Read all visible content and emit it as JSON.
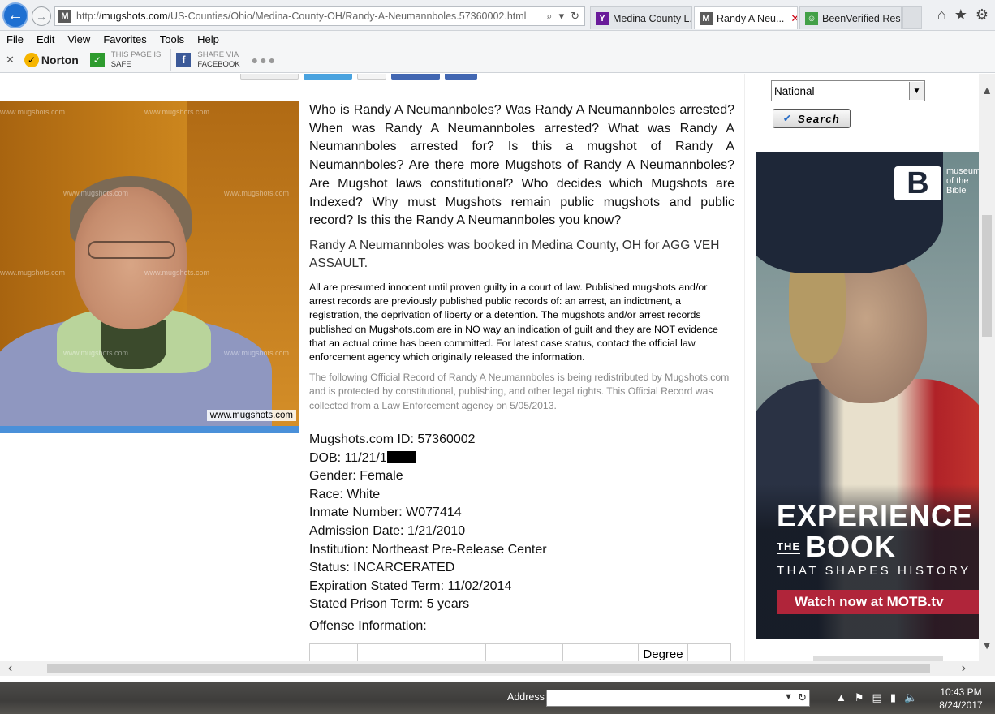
{
  "browser": {
    "url_domain": "mugshots.com",
    "url_prefix": "http://",
    "url_path": "/US-Counties/Ohio/Medina-County-OH/Randy-A-Neumannboles.57360002.html",
    "tabs": [
      {
        "label": "Medina County L...",
        "icon": "Y",
        "icon_color": "#6a1b9a",
        "active": false
      },
      {
        "label": "Randy A Neu...",
        "icon": "M",
        "icon_color": "#5a5a5a",
        "active": true
      },
      {
        "label": "BeenVerified Res...",
        "icon": "☺",
        "icon_color": "#43a047",
        "active": false
      }
    ],
    "menu": [
      "File",
      "Edit",
      "View",
      "Favorites",
      "Tools",
      "Help"
    ],
    "norton_label": "Norton",
    "safe_top": "THIS PAGE IS",
    "safe_bottom": "SAFE",
    "share_top": "SHARE VIA",
    "share_bottom": "FACEBOOK"
  },
  "mugshot": {
    "caption": "www.mugshots.com",
    "watermark": "www.mugshots.com"
  },
  "content": {
    "questions": "Who is Randy A Neumannboles? Was Randy A Neumannboles arrested? When was Randy A Neumannboles arrested? What was Randy A Neumannboles arrested for? Is this a mugshot of Randy A Neumannboles? Are there more Mugshots of Randy A Neumannboles? Are Mugshot laws constitutional? Who decides which Mugshots are Indexed? Why must Mugshots remain public mugshots and public record? Is this the Randy A Neumannboles you know?",
    "booked": "Randy A Neumannboles was booked in Medina County, OH for AGG VEH ASSAULT.",
    "disclaimer": "All are presumed innocent until proven guilty in a court of law. Published mugshots and/or arrest records are previously published public records of: an arrest, an indictment, a registration, the deprivation of liberty or a detention. The mugshots and/or arrest records published on Mugshots.com are in NO way an indication of guilt and they are NOT evidence that an actual crime has been committed. For latest case status, contact the official law enforcement agency which originally released the information.",
    "redistribution": "The following Official Record of Randy A Neumannboles is being redistributed by Mugshots.com and is protected by constitutional, publishing, and other legal rights. This Official Record was collected from a Law Enforcement agency on 5/05/2013.",
    "facts": {
      "id": "Mugshots.com ID: 57360002",
      "dob": "DOB: 11/21/1",
      "gender": "Gender: Female",
      "race": "Race: White",
      "inmate": "Inmate Number: W077414",
      "admission": "Admission Date: 1/21/2010",
      "institution": "Institution: Northeast Pre-Release Center",
      "status": "Status: INCARCERATED",
      "expiration": "Expiration Stated Term: 11/02/2014",
      "term": "Stated Prison Term: 5 years"
    },
    "offense_title": "Offense Information:",
    "offense_header_visible": "Degree"
  },
  "sidebar": {
    "select_value": "National",
    "search_label": "Search"
  },
  "ad": {
    "logo_lines": [
      "museum",
      "of the",
      "Bible"
    ],
    "headline1": "EXPERIENCE",
    "the": "THE",
    "headline2": "BOOK",
    "headline3": "THAT SHAPES HISTORY",
    "cta": "Watch now at MOTB.tv"
  },
  "taskbar": {
    "address_label": "Address",
    "time": "10:43 PM",
    "date": "8/24/2017"
  }
}
